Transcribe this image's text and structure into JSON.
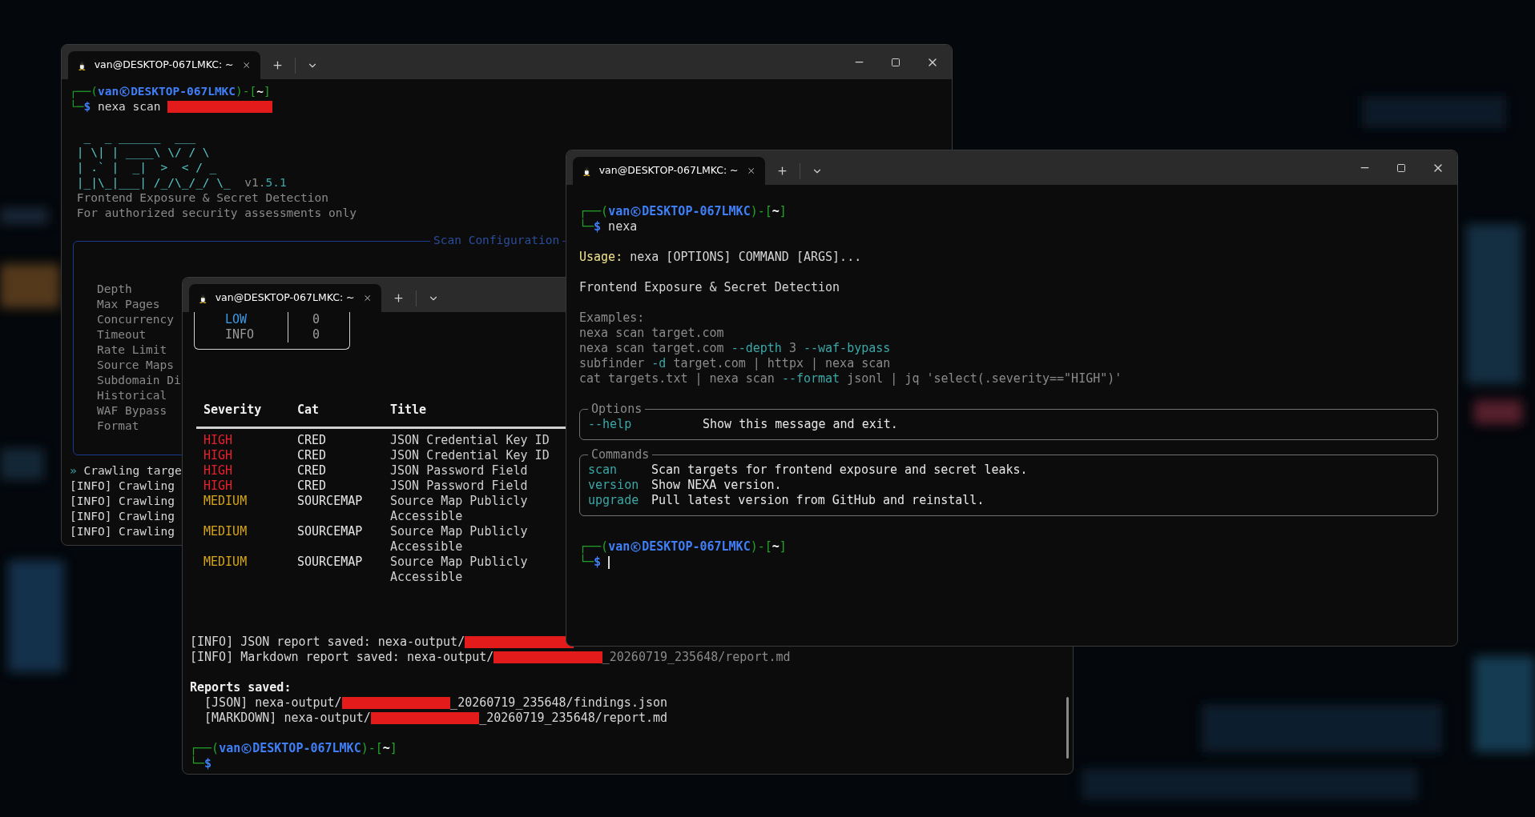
{
  "back_window": {
    "tab_title": "van@DESKTOP-067LMKC: ~",
    "controls": true,
    "header_lines": [
      {
        "kind": "text",
        "segments": [
          {
            "text": "┌──(",
            "kind": "frame"
          },
          {
            "text": "van",
            "kind": "host"
          },
          {
            "kind": "symbol"
          },
          {
            "text": "DESKTOP-067LMKC",
            "kind": "host"
          },
          {
            "text": ")-[",
            "kind": "frame"
          },
          {
            "text": "~",
            "kind": "dir"
          },
          {
            "text": "]",
            "kind": "frame"
          }
        ]
      },
      {
        "kind": "text",
        "segments": [
          {
            "text": "└─",
            "kind": "frame"
          },
          {
            "text": "$",
            "kind": "host"
          },
          {
            "text": " nexa scan ",
            "kind": "plain"
          },
          {
            "kind": "redacted"
          }
        ]
      },
      {
        "kind": "blank"
      },
      {
        "kind": "text",
        "segments": [
          {
            "text": "  _  _ ______  ___",
            "kind": "art"
          }
        ]
      },
      {
        "kind": "text",
        "segments": [
          {
            "text": " | \\| | ____\\ \\/ / \\",
            "kind": "art"
          }
        ]
      },
      {
        "kind": "text",
        "segments": [
          {
            "text": " | .` |  _|  >  < / _",
            "kind": "art"
          }
        ]
      },
      {
        "kind": "text",
        "segments": [
          {
            "text": " |_|\\_|___| /_/\\_/_/ \\_",
            "kind": "art"
          },
          {
            "text": "  v1.",
            "kind": "dim"
          },
          {
            "text": "5.1",
            "kind": "teal"
          }
        ]
      },
      {
        "kind": "text",
        "segments": [
          {
            "text": " Frontend Exposure & Secret Detection",
            "kind": "dim"
          }
        ]
      },
      {
        "kind": "text",
        "segments": [
          {
            "text": " For authorized security assessments only",
            "kind": "dim"
          }
        ]
      }
    ],
    "config": {
      "title": "Scan Configuration",
      "labels": [
        "Depth",
        "Max Pages",
        "Concurrency",
        "Timeout",
        "Rate Limit",
        "Source Maps",
        "Subdomain Di",
        "Historical",
        "WAF Bypass",
        "Format"
      ]
    },
    "log_lines": [
      {
        "kind": "text",
        "segments": [
          {
            "text": "»",
            "kind": "teal"
          },
          {
            "text": " Crawling targe",
            "kind": "plain"
          }
        ]
      },
      {
        "kind": "text",
        "segments": [
          {
            "text": "[INFO] Crawling",
            "kind": "plain"
          }
        ]
      },
      {
        "kind": "text",
        "segments": [
          {
            "text": "[INFO] Crawling",
            "kind": "plain"
          }
        ]
      },
      {
        "kind": "text",
        "segments": [
          {
            "text": "[INFO] Crawling",
            "kind": "plain"
          }
        ]
      },
      {
        "kind": "text",
        "segments": [
          {
            "text": "[INFO] Crawling",
            "kind": "plain"
          }
        ]
      }
    ]
  },
  "middle_window": {
    "tab_title": "van@DESKTOP-067LMKC: ~",
    "stats": [
      {
        "label": "LOW",
        "count": "0",
        "kind": "low"
      },
      {
        "label": "INFO",
        "count": "0",
        "kind": "muted"
      }
    ],
    "table": {
      "columns": [
        "Severity",
        "Cat",
        "Title"
      ],
      "rows": [
        {
          "severity": "HIGH",
          "kind": "high",
          "cat": "CRED",
          "title": "JSON Credential Key ID"
        },
        {
          "severity": "HIGH",
          "kind": "high",
          "cat": "CRED",
          "title": "JSON Credential Key ID"
        },
        {
          "severity": "HIGH",
          "kind": "high",
          "cat": "CRED",
          "title": "JSON Password Field"
        },
        {
          "severity": "HIGH",
          "kind": "high",
          "cat": "CRED",
          "title": "JSON Password Field"
        },
        {
          "severity": "MEDIUM",
          "kind": "medium",
          "cat": "SOURCEMAP",
          "title": "Source Map Publicly Accessible"
        },
        {
          "severity": "MEDIUM",
          "kind": "medium",
          "cat": "SOURCEMAP",
          "title": "Source Map Publicly Accessible"
        },
        {
          "severity": "MEDIUM",
          "kind": "medium",
          "cat": "SOURCEMAP",
          "title": "Source Map Publicly Accessible"
        }
      ]
    },
    "footer_lines": [
      {
        "kind": "text",
        "segments": [
          {
            "text": "[INFO] JSON report saved: nexa-output/",
            "kind": "plain"
          },
          {
            "kind": "redacted"
          }
        ]
      },
      {
        "kind": "text",
        "segments": [
          {
            "text": "[INFO] Markdown report saved: nexa-output/",
            "kind": "plain"
          },
          {
            "kind": "redacted"
          },
          {
            "text": "_20260719_235648/report.md",
            "kind": "dim"
          }
        ]
      },
      {
        "kind": "blank"
      },
      {
        "kind": "text",
        "segments": [
          {
            "text": "Reports saved:",
            "kind": "bold"
          }
        ]
      },
      {
        "kind": "text",
        "segments": [
          {
            "text": "  [JSON] nexa-output/",
            "kind": "plain"
          },
          {
            "kind": "redacted"
          },
          {
            "text": "_20260719_235648/findings.json",
            "kind": "plain"
          }
        ]
      },
      {
        "kind": "text",
        "segments": [
          {
            "text": "  [MARKDOWN] nexa-output/",
            "kind": "plain"
          },
          {
            "kind": "redacted"
          },
          {
            "text": "_20260719_235648/report.md",
            "kind": "plain"
          }
        ]
      },
      {
        "kind": "blank"
      },
      {
        "kind": "text",
        "segments": [
          {
            "text": "┌──(",
            "kind": "frame"
          },
          {
            "text": "van",
            "kind": "host"
          },
          {
            "kind": "symbol"
          },
          {
            "text": "DESKTOP-067LMKC",
            "kind": "host"
          },
          {
            "text": ")-[",
            "kind": "frame"
          },
          {
            "text": "~",
            "kind": "dir"
          },
          {
            "text": "]",
            "kind": "frame"
          }
        ]
      },
      {
        "kind": "text",
        "segments": [
          {
            "text": "└─",
            "kind": "frame"
          },
          {
            "text": "$",
            "kind": "host"
          }
        ]
      }
    ]
  },
  "front_window": {
    "tab_title": "van@DESKTOP-067LMKC: ~",
    "controls": true,
    "header_lines": [
      {
        "kind": "text",
        "segments": [
          {
            "text": "┌──(",
            "kind": "frame"
          },
          {
            "text": "van",
            "kind": "host"
          },
          {
            "kind": "symbol"
          },
          {
            "text": "DESKTOP-067LMKC",
            "kind": "host"
          },
          {
            "text": ")-[",
            "kind": "frame"
          },
          {
            "text": "~",
            "kind": "dir"
          },
          {
            "text": "]",
            "kind": "frame"
          }
        ]
      },
      {
        "kind": "text",
        "segments": [
          {
            "text": "└─",
            "kind": "frame"
          },
          {
            "text": "$",
            "kind": "host"
          },
          {
            "text": " nexa",
            "kind": "plain"
          }
        ]
      },
      {
        "kind": "blank"
      },
      {
        "kind": "text",
        "segments": [
          {
            "text": "Usage:",
            "kind": "yellow"
          },
          {
            "text": " nexa [OPTIONS] COMMAND [ARGS]...",
            "kind": "plain"
          }
        ]
      },
      {
        "kind": "blank"
      },
      {
        "kind": "text",
        "segments": [
          {
            "text": "Frontend Exposure & Secret Detection",
            "kind": "plain"
          }
        ]
      },
      {
        "kind": "blank"
      },
      {
        "kind": "text",
        "segments": [
          {
            "text": "Examples:",
            "kind": "dim"
          }
        ]
      },
      {
        "kind": "text",
        "segments": [
          {
            "text": "nexa scan target.com",
            "kind": "dim"
          }
        ]
      },
      {
        "kind": "text",
        "segments": [
          {
            "text": "nexa scan target.com ",
            "kind": "dim"
          },
          {
            "text": "--depth",
            "kind": "teal"
          },
          {
            "text": " 3 ",
            "kind": "dim"
          },
          {
            "text": "--waf-bypass",
            "kind": "teal"
          }
        ]
      },
      {
        "kind": "text",
        "segments": [
          {
            "text": "subfinder ",
            "kind": "dim"
          },
          {
            "text": "-d",
            "kind": "teal"
          },
          {
            "text": " target.com | httpx | nexa scan",
            "kind": "dim"
          }
        ]
      },
      {
        "kind": "text",
        "segments": [
          {
            "text": "cat targets.txt | nexa scan ",
            "kind": "dim"
          },
          {
            "text": "--format",
            "kind": "teal"
          },
          {
            "text": " jsonl | jq 'select(.severity==\"HIGH\")'",
            "kind": "dim"
          }
        ]
      }
    ],
    "options": {
      "title": "Options",
      "rows": [
        {
          "name": "--help",
          "description": "Show this message and exit."
        }
      ]
    },
    "commands": {
      "title": "Commands",
      "rows": [
        {
          "name": "scan",
          "description": "Scan targets for frontend exposure and secret leaks."
        },
        {
          "name": "version",
          "description": "Show NEXA version."
        },
        {
          "name": "upgrade",
          "description": "Pull latest version from GitHub and reinstall."
        }
      ]
    },
    "footer_lines": [
      {
        "kind": "blank"
      },
      {
        "kind": "text",
        "segments": [
          {
            "text": "┌──(",
            "kind": "frame"
          },
          {
            "text": "van",
            "kind": "host"
          },
          {
            "kind": "symbol"
          },
          {
            "text": "DESKTOP-067LMKC",
            "kind": "host"
          },
          {
            "text": ")-[",
            "kind": "frame"
          },
          {
            "text": "~",
            "kind": "dir"
          },
          {
            "text": "]",
            "kind": "frame"
          }
        ]
      },
      {
        "kind": "text",
        "segments": [
          {
            "text": "└─",
            "kind": "frame"
          },
          {
            "text": "$",
            "kind": "host"
          },
          {
            "kind": "cursor"
          }
        ]
      }
    ]
  }
}
